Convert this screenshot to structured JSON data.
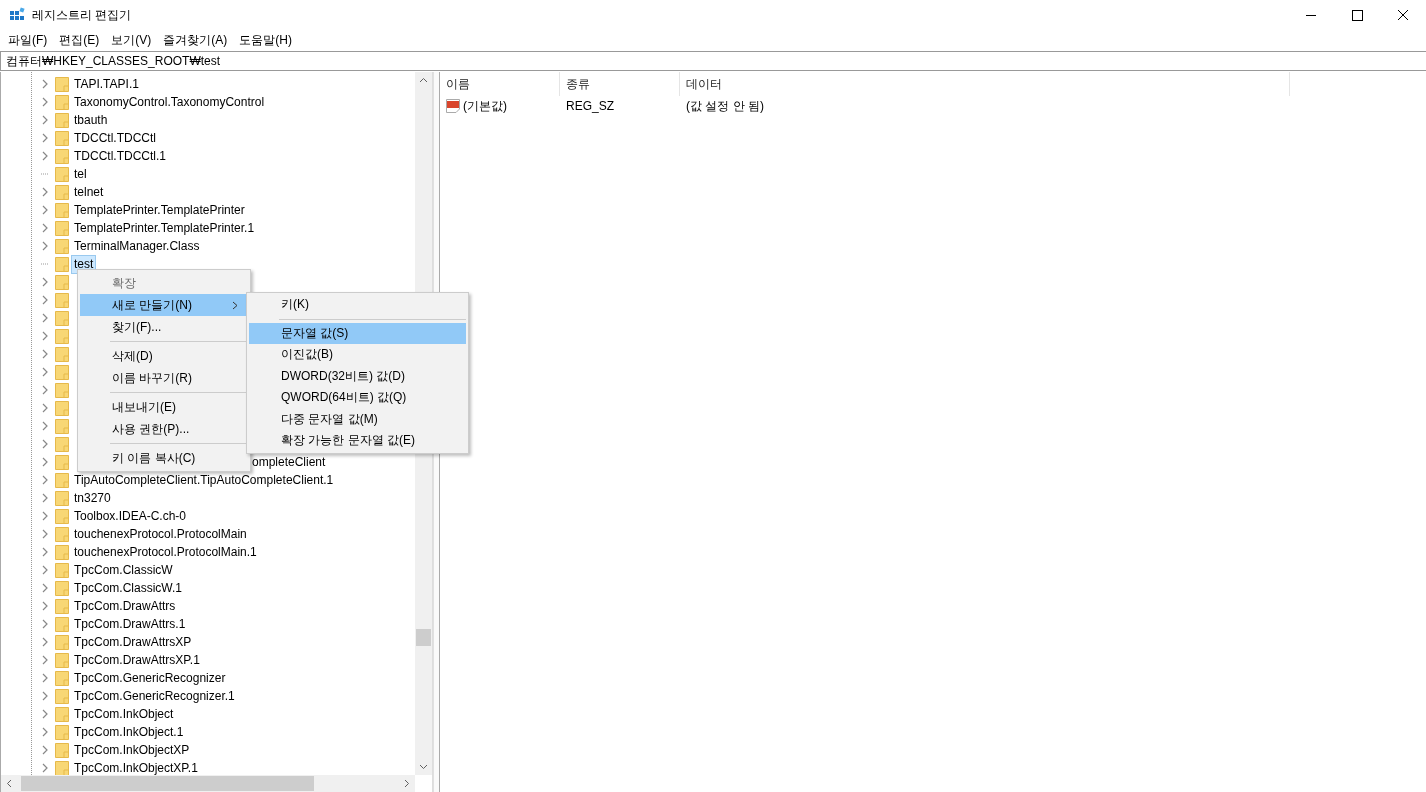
{
  "window": {
    "title": "레지스트리 편집기"
  },
  "menu_bar": [
    "파일(F)",
    "편집(E)",
    "보기(V)",
    "즐겨찾기(A)",
    "도움말(H)"
  ],
  "address": "컴퓨터₩HKEY_CLASSES_ROOT₩test",
  "tree": {
    "rows": [
      {
        "label": "TAPI.TAPI.1",
        "expandable": true,
        "selected": false
      },
      {
        "label": "TaxonomyControl.TaxonomyControl",
        "expandable": true,
        "selected": false
      },
      {
        "label": "tbauth",
        "expandable": true,
        "selected": false
      },
      {
        "label": "TDCCtl.TDCCtl",
        "expandable": true,
        "selected": false
      },
      {
        "label": "TDCCtl.TDCCtl.1",
        "expandable": true,
        "selected": false
      },
      {
        "label": "tel",
        "expandable": false,
        "selected": false
      },
      {
        "label": "telnet",
        "expandable": true,
        "selected": false
      },
      {
        "label": "TemplatePrinter.TemplatePrinter",
        "expandable": true,
        "selected": false
      },
      {
        "label": "TemplatePrinter.TemplatePrinter.1",
        "expandable": true,
        "selected": false
      },
      {
        "label": "TerminalManager.Class",
        "expandable": true,
        "selected": false
      },
      {
        "label": "test",
        "expandable": false,
        "selected": true
      },
      {
        "expandable": true,
        "selected": false
      },
      {
        "expandable": true,
        "selected": false
      },
      {
        "expandable": true,
        "selected": false
      },
      {
        "expandable": true,
        "selected": false
      },
      {
        "expandable": true,
        "selected": false
      },
      {
        "expandable": true,
        "selected": false
      },
      {
        "expandable": true,
        "selected": false
      },
      {
        "expandable": true,
        "selected": false
      },
      {
        "expandable": true,
        "selected": false
      },
      {
        "expandable": true,
        "selected": false
      },
      {
        "tail": "ompleteClient",
        "expandable": true,
        "selected": false
      },
      {
        "label": "TipAutoCompleteClient.TipAutoCompleteClient.1",
        "expandable": true,
        "selected": false
      },
      {
        "label": "tn3270",
        "expandable": true,
        "selected": false
      },
      {
        "label": "Toolbox.IDEA-C.ch-0",
        "expandable": true,
        "selected": false
      },
      {
        "label": "touchenexProtocol.ProtocolMain",
        "expandable": true,
        "selected": false
      },
      {
        "label": "touchenexProtocol.ProtocolMain.1",
        "expandable": true,
        "selected": false
      },
      {
        "label": "TpcCom.ClassicW",
        "expandable": true,
        "selected": false
      },
      {
        "label": "TpcCom.ClassicW.1",
        "expandable": true,
        "selected": false
      },
      {
        "label": "TpcCom.DrawAttrs",
        "expandable": true,
        "selected": false
      },
      {
        "label": "TpcCom.DrawAttrs.1",
        "expandable": true,
        "selected": false
      },
      {
        "label": "TpcCom.DrawAttrsXP",
        "expandable": true,
        "selected": false
      },
      {
        "label": "TpcCom.DrawAttrsXP.1",
        "expandable": true,
        "selected": false
      },
      {
        "label": "TpcCom.GenericRecognizer",
        "expandable": true,
        "selected": false
      },
      {
        "label": "TpcCom.GenericRecognizer.1",
        "expandable": true,
        "selected": false
      },
      {
        "label": "TpcCom.InkObject",
        "expandable": true,
        "selected": false
      },
      {
        "label": "TpcCom.InkObject.1",
        "expandable": true,
        "selected": false
      },
      {
        "label": "TpcCom.InkObjectXP",
        "expandable": true,
        "selected": false
      },
      {
        "label": "TpcCom.InkObjectXP.1",
        "expandable": true,
        "selected": false
      }
    ]
  },
  "context_menu": {
    "items": [
      {
        "kind": "item",
        "label": "확장",
        "disabled": true,
        "submenu": false,
        "selected": false
      },
      {
        "kind": "item",
        "label": "새로 만들기(N)",
        "disabled": false,
        "submenu": true,
        "selected": true
      },
      {
        "kind": "item",
        "label": "찾기(F)...",
        "disabled": false,
        "submenu": false,
        "selected": false
      },
      {
        "kind": "separator"
      },
      {
        "kind": "item",
        "label": "삭제(D)",
        "disabled": false,
        "submenu": false,
        "selected": false
      },
      {
        "kind": "item",
        "label": "이름 바꾸기(R)",
        "disabled": false,
        "submenu": false,
        "selected": false
      },
      {
        "kind": "separator"
      },
      {
        "kind": "item",
        "label": "내보내기(E)",
        "disabled": false,
        "submenu": false,
        "selected": false
      },
      {
        "kind": "item",
        "label": "사용 권한(P)...",
        "disabled": false,
        "submenu": false,
        "selected": false
      },
      {
        "kind": "separator"
      },
      {
        "kind": "item",
        "label": "키 이름 복사(C)",
        "disabled": false,
        "submenu": false,
        "selected": false
      }
    ]
  },
  "submenu": {
    "items": [
      {
        "kind": "item",
        "label": "키(K)",
        "selected": false
      },
      {
        "kind": "separator"
      },
      {
        "kind": "item",
        "label": "문자열 값(S)",
        "selected": true
      },
      {
        "kind": "item",
        "label": "이진값(B)",
        "selected": false
      },
      {
        "kind": "item",
        "label": "DWORD(32비트) 값(D)",
        "selected": false
      },
      {
        "kind": "item",
        "label": "QWORD(64비트) 값(Q)",
        "selected": false
      },
      {
        "kind": "item",
        "label": "다중 문자열 값(M)",
        "selected": false
      },
      {
        "kind": "item",
        "label": "확장 가능한 문자열 값(E)",
        "selected": false
      }
    ]
  },
  "values": {
    "columns": [
      "이름",
      "종류",
      "데이터"
    ],
    "rows": [
      {
        "name": "(기본값)",
        "type": "REG_SZ",
        "data": "(값 설정 안 됨)"
      }
    ]
  }
}
